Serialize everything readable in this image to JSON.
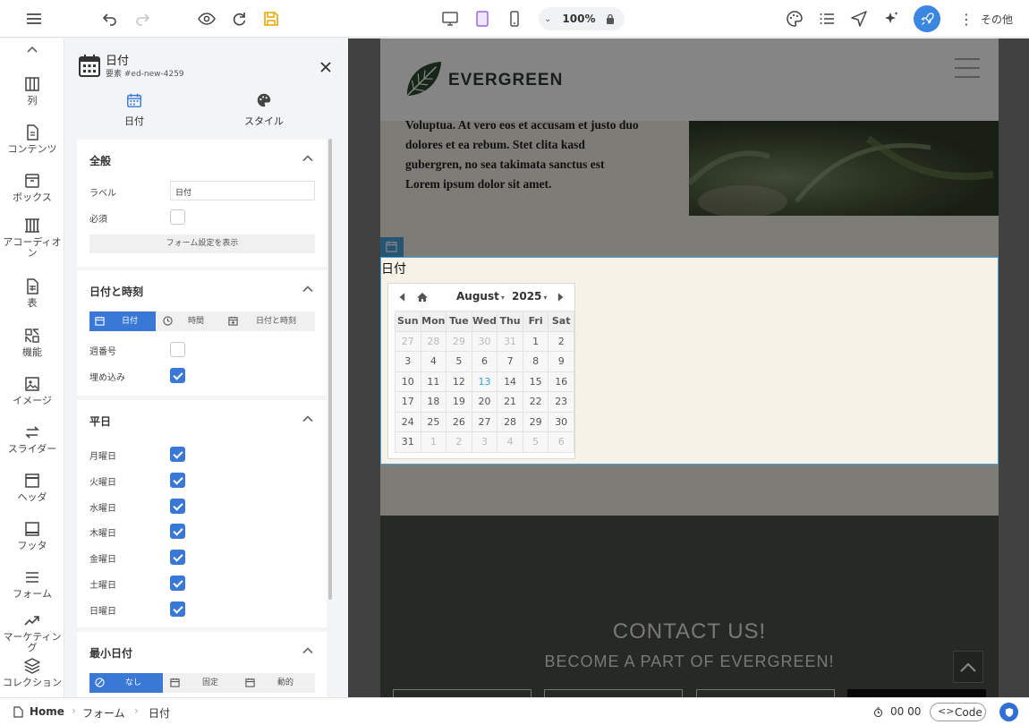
{
  "toolbar": {
    "zoom": "100%",
    "more_label": "その他"
  },
  "rail": [
    {
      "label": "列",
      "icon": "columns-icon"
    },
    {
      "label": "コンテンツ",
      "icon": "document-icon"
    },
    {
      "label": "ボックス",
      "icon": "box-icon"
    },
    {
      "label": "アコーディオン",
      "icon": "accordion-icon"
    },
    {
      "label": "表",
      "icon": "table-icon"
    },
    {
      "label": "機能",
      "icon": "features-icon"
    },
    {
      "label": "イメージ",
      "icon": "image-icon"
    },
    {
      "label": "スライダー",
      "icon": "slider-icon"
    },
    {
      "label": "ヘッダ",
      "icon": "header-icon"
    },
    {
      "label": "フッタ",
      "icon": "footer-icon"
    },
    {
      "label": "フォーム",
      "icon": "form-icon"
    },
    {
      "label": "マーケティング",
      "icon": "marketing-icon"
    },
    {
      "label": "コレクション",
      "icon": "collection-icon"
    }
  ],
  "panel": {
    "title": "日付",
    "subtitle": "要素 #ed-new-4259",
    "tabs": [
      {
        "label": "日付",
        "icon": "calendar-icon",
        "active": true
      },
      {
        "label": "スタイル",
        "icon": "palette-icon",
        "active": false
      }
    ],
    "general": {
      "title": "全般",
      "label_label": "ラベル",
      "label_value": "日付",
      "required_label": "必須",
      "form_settings_button": "フォーム設定を表示"
    },
    "datetime": {
      "title": "日付と時刻",
      "segments": [
        "日付",
        "時間",
        "日付と時刻"
      ],
      "week_number_label": "週番号",
      "embed_label": "埋め込み"
    },
    "weekdays": {
      "title": "平日",
      "days": [
        "月曜日",
        "火曜日",
        "水曜日",
        "木曜日",
        "金曜日",
        "土曜日",
        "日曜日"
      ]
    },
    "min_date": {
      "title": "最小日付",
      "segments": [
        "なし",
        "固定",
        "動的"
      ]
    }
  },
  "page": {
    "brand": "EVERGREEN",
    "body_text": [
      "Voluptua. At vero eos et accusam et justo duo",
      "dolores et ea rebum. Stet clita kasd",
      "gubergren, no sea takimata sanctus est",
      "Lorem ipsum dolor sit amet."
    ],
    "date_label": "日付",
    "calendar": {
      "month": "August",
      "year": "2025",
      "weekdays": [
        "Sun",
        "Mon",
        "Tue",
        "Wed",
        "Thu",
        "Fri",
        "Sat"
      ],
      "weeks": [
        [
          "27",
          "28",
          "29",
          "30",
          "31",
          "1",
          "2"
        ],
        [
          "3",
          "4",
          "5",
          "6",
          "7",
          "8",
          "9"
        ],
        [
          "10",
          "11",
          "12",
          "13",
          "14",
          "15",
          "16"
        ],
        [
          "17",
          "18",
          "19",
          "20",
          "21",
          "22",
          "23"
        ],
        [
          "24",
          "25",
          "26",
          "27",
          "28",
          "29",
          "30"
        ],
        [
          "31",
          "1",
          "2",
          "3",
          "4",
          "5",
          "6"
        ]
      ],
      "today": "13"
    },
    "contact_title": "CONTACT US!",
    "contact_subtitle": "BECOME A PART OF EVERGREEN!"
  },
  "bottom": {
    "breadcrumb": [
      "Home",
      "フォーム",
      "日付"
    ],
    "timer": "00 00",
    "code_label": "Code"
  },
  "colors": {
    "accent": "#3a78d6",
    "selection": "#4aa3df",
    "canvas_dim": "#7d7d7d",
    "footer": "#4a5048"
  }
}
